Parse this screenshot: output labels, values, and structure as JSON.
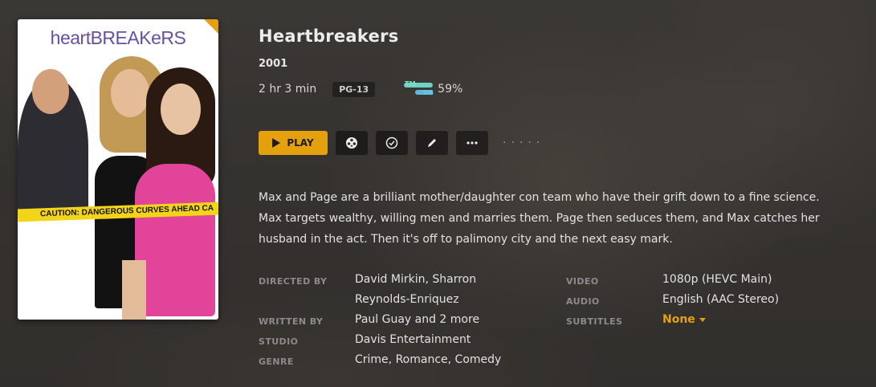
{
  "poster": {
    "title_art": "heartBREAKeRS",
    "tape_text": "CAUTION:  DANGEROUS  CURVES AHEAD  CA"
  },
  "movie": {
    "title": "Heartbreakers",
    "year": "2001",
    "duration": "2 hr 3 min",
    "content_rating": "PG-13",
    "tmdb_tm": "TM",
    "tmdb_db": "DB",
    "tmdb_score": "59%"
  },
  "actions": {
    "play_label": "PLAY",
    "trailer_icon": "film-reel-icon",
    "watched_icon": "check-circle-icon",
    "edit_icon": "pencil-icon",
    "more_icon": "more-icon",
    "dots": "·····"
  },
  "summary": "Max and Page are a brilliant mother/daughter con team who have their grift down to a fine science. Max targets wealthy, willing men and marries them. Page then seduces them, and Max catches her husband in the act. Then it's off to palimony city and the next easy mark.",
  "details": {
    "directed_by_label": "DIRECTED BY",
    "directed_by_line1": "David Mirkin, Sharron",
    "directed_by_line2": "Reynolds-Enriquez",
    "written_by_label": "WRITTEN BY",
    "written_by": "Paul Guay and 2 more",
    "studio_label": "STUDIO",
    "studio": "Davis Entertainment",
    "genre_label": "GENRE",
    "genre": "Crime, Romance, Comedy",
    "video_label": "VIDEO",
    "video": "1080p (HEVC Main)",
    "audio_label": "AUDIO",
    "audio": "English (AAC Stereo)",
    "subtitles_label": "SUBTITLES",
    "subtitles": "None"
  },
  "colors": {
    "accent": "#e5a00d",
    "background": "#3d3b38"
  }
}
